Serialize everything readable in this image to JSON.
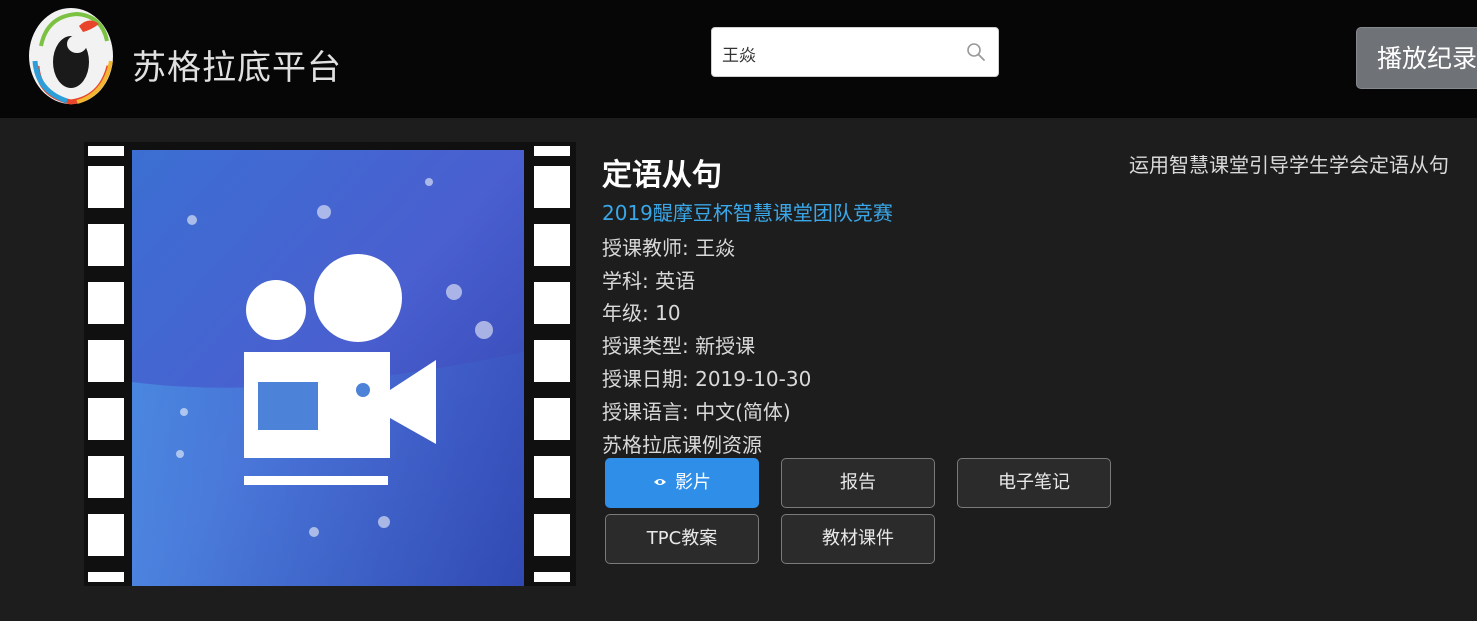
{
  "header": {
    "brand": "苏格拉底平台",
    "search": {
      "value": "王焱",
      "placeholder": ""
    },
    "history_button": "播放纪录"
  },
  "lesson": {
    "title": "定语从句",
    "event": "2019醍摩豆杯智慧课堂团队竞赛",
    "teacher": "授课教师: 王焱",
    "subject": "学科: 英语",
    "grade": "年级: 10",
    "type": "授课类型: 新授课",
    "date": "授课日期: 2019-10-30",
    "language": "授课语言: 中文(简体)",
    "source": "苏格拉底课例资源",
    "description": "运用智慧课堂引导学生学会定语从句"
  },
  "resources": {
    "video": "影片",
    "report": "报告",
    "notes": "电子笔记",
    "tpc": "TPC教案",
    "materials": "教材课件"
  },
  "colors": {
    "accent": "#2f8fe8",
    "event_link": "#3aa7e8",
    "header_bg": "#060606",
    "page_bg": "#1d1d1d"
  },
  "icons": {
    "logo": "socrates-logo",
    "search": "search-icon",
    "eye": "eye-icon",
    "thumbnail": "video-camera-icon"
  }
}
